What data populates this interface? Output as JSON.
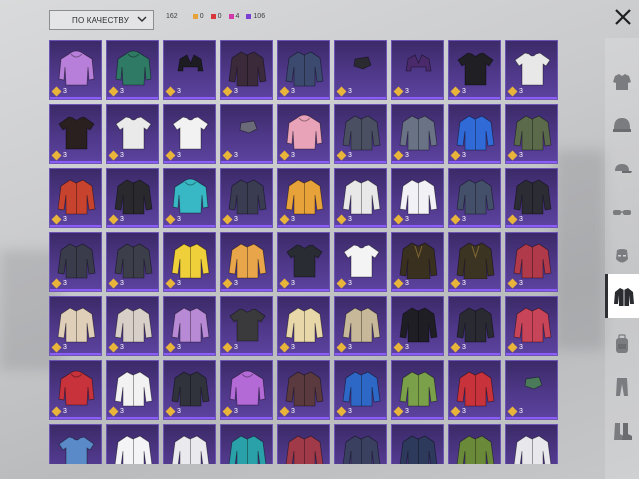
{
  "toolbar": {
    "sort_value": "ПО КАЧЕСТВУ",
    "total_count": "162",
    "rarity_counts": [
      {
        "label": "0",
        "color": "#e8a23a"
      },
      {
        "label": "0",
        "color": "#d8383a"
      },
      {
        "label": "4",
        "color": "#d23aa8"
      },
      {
        "label": "106",
        "color": "#7b3fd6"
      }
    ]
  },
  "grid": {
    "count_label": "3",
    "items": [
      {
        "shape": "hoodie",
        "color": "#b77fd9"
      },
      {
        "shape": "hoodie",
        "color": "#2f7a64"
      },
      {
        "shape": "vest",
        "color": "#1c1c22"
      },
      {
        "shape": "jacket",
        "color": "#3a2a3a"
      },
      {
        "shape": "jacket",
        "color": "#3b4a6e"
      },
      {
        "shape": "small",
        "color": "#2a2a30"
      },
      {
        "shape": "vest",
        "color": "#4a2a6a"
      },
      {
        "shape": "tshirt",
        "color": "#1f1f24"
      },
      {
        "shape": "tshirt",
        "color": "#e8e8e8"
      },
      {
        "shape": "tshirt",
        "color": "#2a2020"
      },
      {
        "shape": "tshirt",
        "color": "#eaeaea"
      },
      {
        "shape": "tshirt",
        "color": "#f2f2f2"
      },
      {
        "shape": "small",
        "color": "#6a6a78"
      },
      {
        "shape": "hoodie",
        "color": "#e9a3b8"
      },
      {
        "shape": "jacket",
        "color": "#4a5062"
      },
      {
        "shape": "jacket",
        "color": "#6a7286"
      },
      {
        "shape": "jacket",
        "color": "#2f6ad6"
      },
      {
        "shape": "jacket",
        "color": "#5a6a4a"
      },
      {
        "shape": "jacket",
        "color": "#c8432e"
      },
      {
        "shape": "jacket",
        "color": "#2a2a2e"
      },
      {
        "shape": "hoodie",
        "color": "#38b8c4"
      },
      {
        "shape": "jacket",
        "color": "#3a3c52"
      },
      {
        "shape": "jacket",
        "color": "#e8a23a"
      },
      {
        "shape": "jacket",
        "color": "#e8e8e8"
      },
      {
        "shape": "jacket",
        "color": "#f2f2f6"
      },
      {
        "shape": "jacket",
        "color": "#44506a"
      },
      {
        "shape": "jacket",
        "color": "#2c2c34"
      },
      {
        "shape": "jacket",
        "color": "#3a3c4c"
      },
      {
        "shape": "jacket",
        "color": "#3c3e4a"
      },
      {
        "shape": "jacket",
        "color": "#f0d03a"
      },
      {
        "shape": "jacket",
        "color": "#e8a54a"
      },
      {
        "shape": "tshirt",
        "color": "#2a2c34"
      },
      {
        "shape": "tshirt",
        "color": "#f4f4f4"
      },
      {
        "shape": "coat",
        "color": "#3a3020"
      },
      {
        "shape": "coat",
        "color": "#3c3422"
      },
      {
        "shape": "jacket",
        "color": "#b03a4a"
      },
      {
        "shape": "jacket",
        "color": "#e0cfb8"
      },
      {
        "shape": "jacket",
        "color": "#d8d0c8"
      },
      {
        "shape": "jacket",
        "color": "#b88ad6"
      },
      {
        "shape": "tshirt",
        "color": "#3a3a3c"
      },
      {
        "shape": "jacket",
        "color": "#e8d7a8"
      },
      {
        "shape": "jacket",
        "color": "#c8b89a"
      },
      {
        "shape": "jacket",
        "color": "#1e1e24"
      },
      {
        "shape": "jacket",
        "color": "#2a2a32"
      },
      {
        "shape": "jacket",
        "color": "#c84458"
      },
      {
        "shape": "hoodie",
        "color": "#c8323a"
      },
      {
        "shape": "jacket",
        "color": "#f2f2f2"
      },
      {
        "shape": "jacket",
        "color": "#30323c"
      },
      {
        "shape": "hoodie",
        "color": "#b36ad6"
      },
      {
        "shape": "jacket",
        "color": "#5a3a3e"
      },
      {
        "shape": "jacket",
        "color": "#2e68c6"
      },
      {
        "shape": "jacket",
        "color": "#7aa04a"
      },
      {
        "shape": "jacket",
        "color": "#c8323a"
      },
      {
        "shape": "small",
        "color": "#4a7a5a"
      },
      {
        "shape": "tshirt",
        "color": "#5a8ac8"
      },
      {
        "shape": "jacket",
        "color": "#f4f4f6"
      },
      {
        "shape": "jacket",
        "color": "#eaeaee"
      },
      {
        "shape": "jacket",
        "color": "#2aa0a8"
      },
      {
        "shape": "jacket",
        "color": "#a03a48"
      },
      {
        "shape": "jacket",
        "color": "#3a4060"
      },
      {
        "shape": "jacket",
        "color": "#2e3a5c"
      },
      {
        "shape": "jacket",
        "color": "#6a8a3a"
      },
      {
        "shape": "jacket",
        "color": "#e8e8ec"
      }
    ]
  },
  "sidebar": {
    "categories": [
      {
        "name": "outfit-set-icon"
      },
      {
        "name": "helmet-icon"
      },
      {
        "name": "cap-icon"
      },
      {
        "name": "glasses-icon"
      },
      {
        "name": "mask-icon"
      },
      {
        "name": "jacket-icon",
        "active": true
      },
      {
        "name": "backpack-icon"
      },
      {
        "name": "pants-icon"
      },
      {
        "name": "boots-icon"
      }
    ]
  }
}
